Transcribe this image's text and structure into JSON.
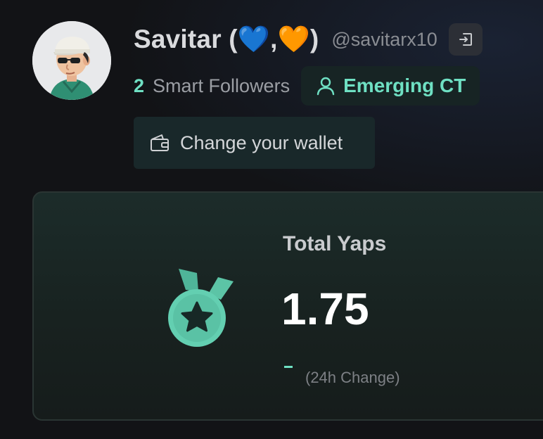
{
  "profile": {
    "display_name": "Savitar (💙,🧡)",
    "handle": "@savitarx10",
    "avatar_icon": "cartoon-avatar"
  },
  "followers": {
    "count": "2",
    "label": "Smart Followers"
  },
  "badge": {
    "label": "Emerging CT",
    "icon": "user-icon"
  },
  "wallet": {
    "label": "Change your wallet",
    "icon": "wallet-icon"
  },
  "yaps_card": {
    "title": "Total Yaps",
    "value": "1.75",
    "change_value": "-",
    "change_label": "(24h Change)",
    "icon": "medal-icon"
  },
  "colors": {
    "accent": "#6fe0c3",
    "background": "#121316",
    "card_background": "#1c2c2a"
  }
}
